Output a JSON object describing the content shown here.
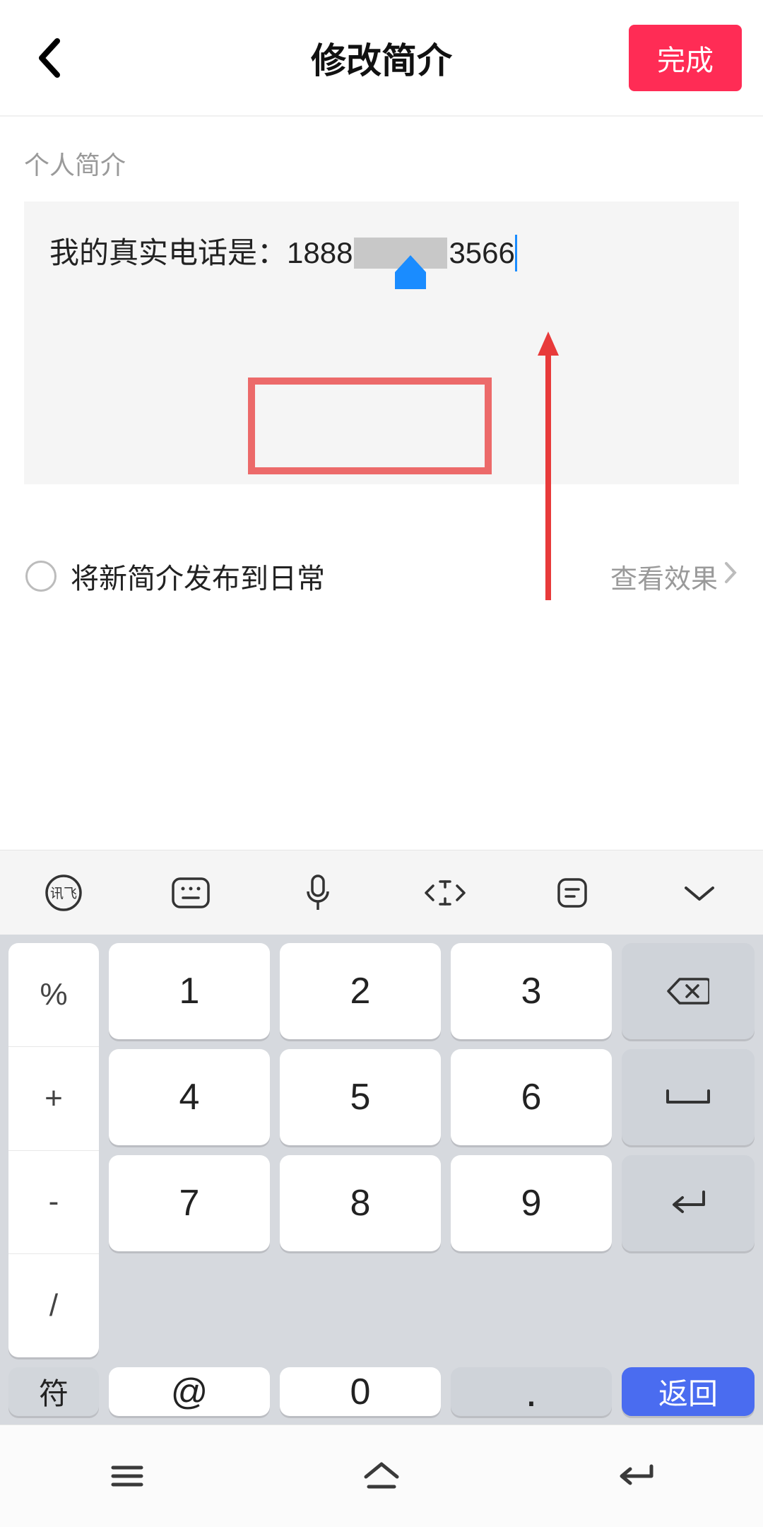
{
  "header": {
    "title": "修改简介",
    "done_label": "完成"
  },
  "section_label": "个人简介",
  "bio": {
    "prefix": "我的真实电话是：",
    "phone_visible_start": "1888",
    "phone_visible_end": "3566"
  },
  "publish": {
    "label": "将新简介发布到日常",
    "preview_label": "查看效果"
  },
  "keyboard": {
    "ime_brand": "讯飞",
    "left_symbols": [
      "%",
      "+",
      "-",
      "/"
    ],
    "digits": [
      "1",
      "2",
      "3",
      "4",
      "5",
      "6",
      "7",
      "8",
      "9",
      "0"
    ],
    "at": "@",
    "sym_label": "符",
    "return_label": "返回"
  }
}
